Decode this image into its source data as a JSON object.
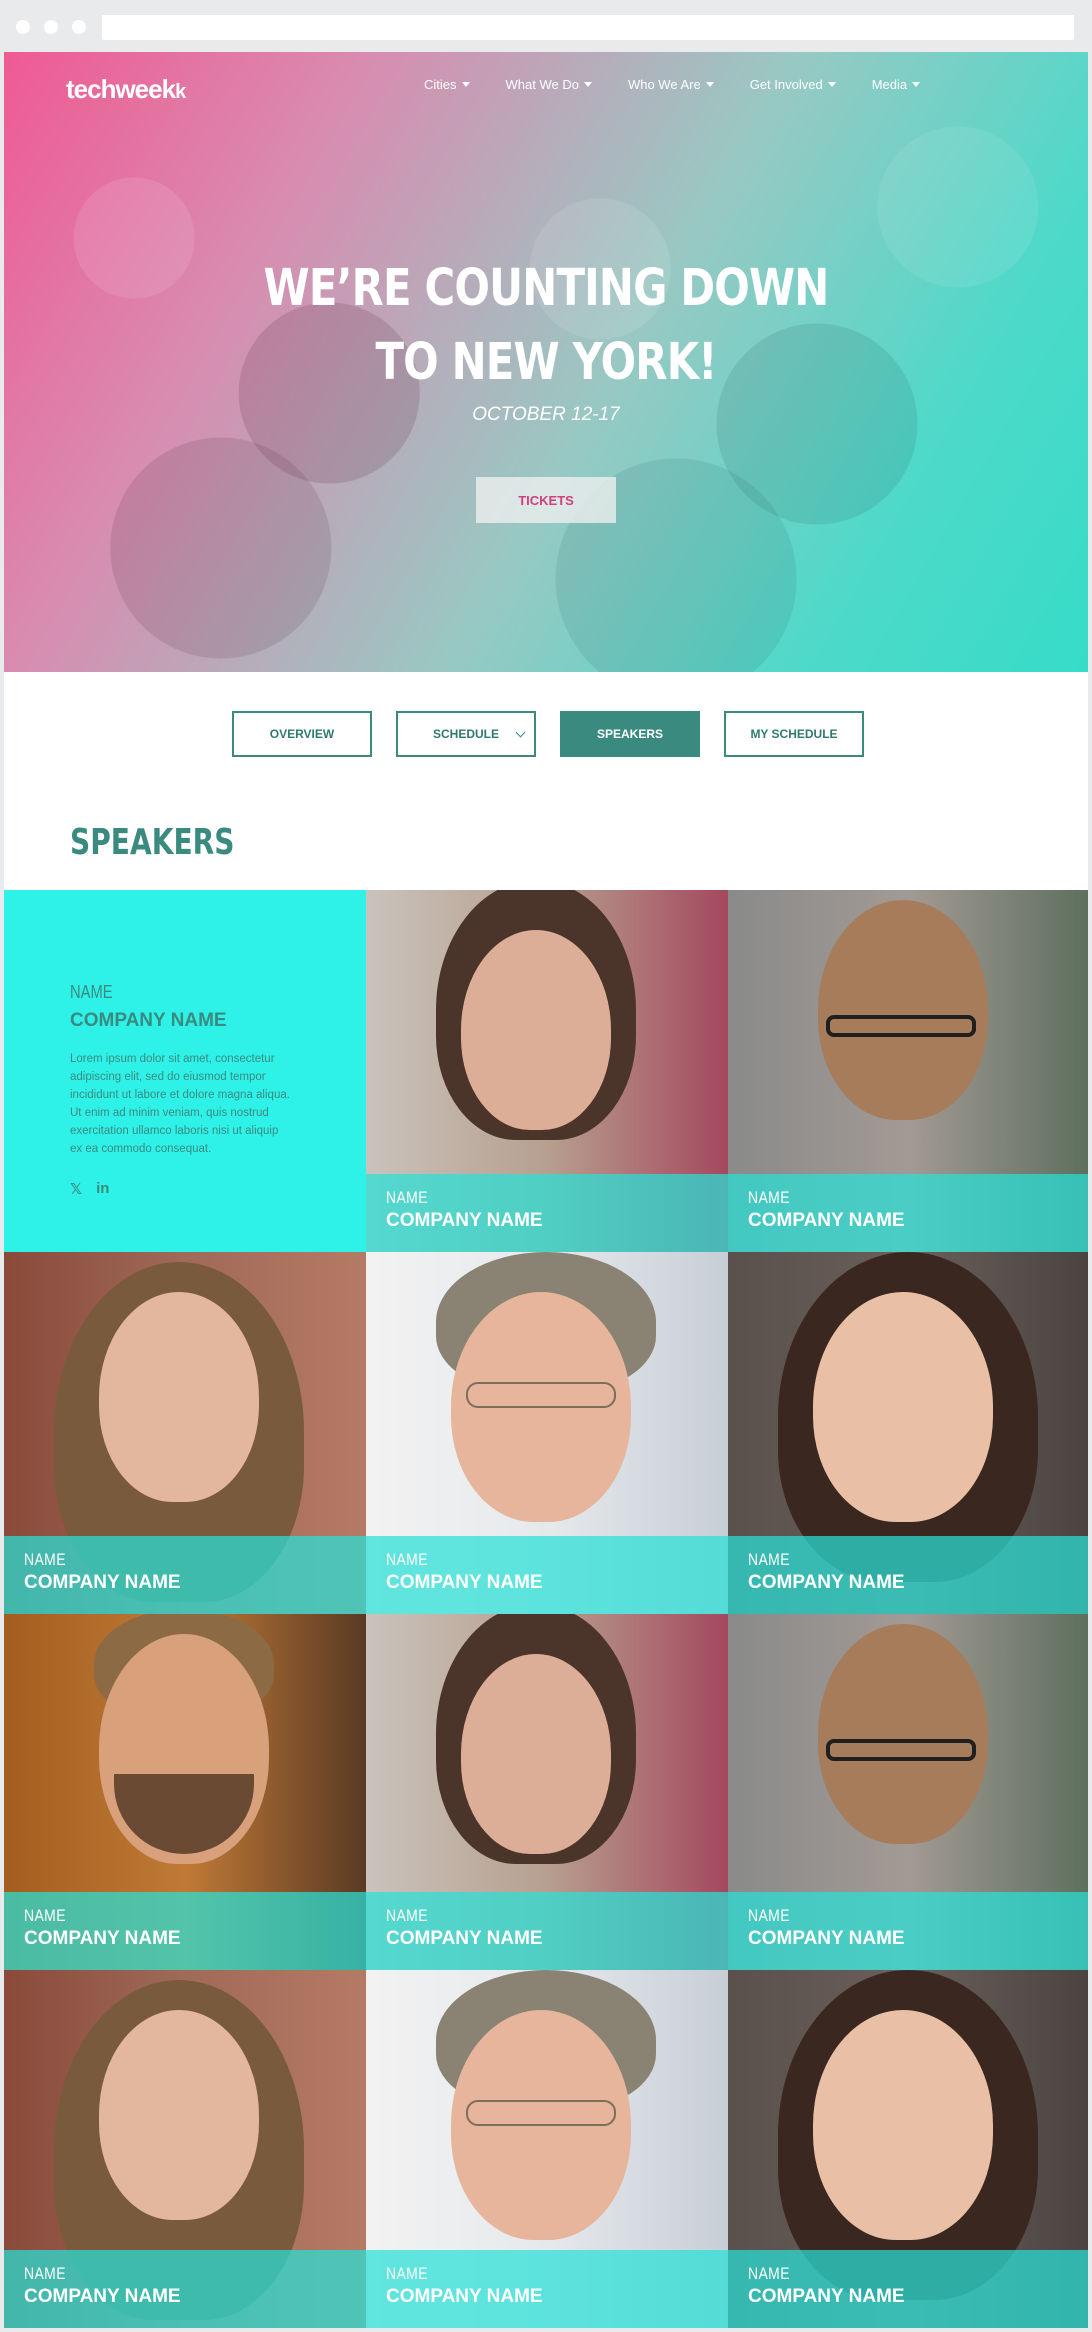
{
  "brand": {
    "logo": "techweek",
    "logo_mark": "k"
  },
  "nav": [
    {
      "label": "Cities"
    },
    {
      "label": "What We Do"
    },
    {
      "label": "Who We Are"
    },
    {
      "label": "Get Involved"
    },
    {
      "label": "Media"
    }
  ],
  "hero": {
    "title_line1": "WE’RE COUNTING DOWN",
    "title_line2": "TO NEW YORK!",
    "date": "OCTOBER 12-17",
    "cta": "TICKETS"
  },
  "tabs": [
    {
      "label": "OVERVIEW"
    },
    {
      "label": "SCHEDULE"
    },
    {
      "label": "SPEAKERS"
    },
    {
      "label": "MY SCHEDULE"
    }
  ],
  "section_title": "SPEAKERS",
  "featured_speaker": {
    "name": "NAME",
    "company": "COMPANY NAME",
    "bio": "Lorem ipsum dolor sit amet, consectetur adipiscing elit, sed do eiusmod tempor incididunt ut labore et dolore magna aliqua. Ut enim ad minim veniam, quis nostrud exercitation ullamco laboris nisi ut aliquip ex ea commodo consequat.",
    "social": [
      "twitter",
      "linkedin"
    ]
  },
  "speakers": [
    {
      "name": "NAME",
      "company": "COMPANY NAME"
    },
    {
      "name": "NAME",
      "company": "COMPANY NAME"
    },
    {
      "name": "NAME",
      "company": "COMPANY NAME"
    },
    {
      "name": "NAME",
      "company": "COMPANY NAME"
    },
    {
      "name": "NAME",
      "company": "COMPANY NAME"
    },
    {
      "name": "NAME",
      "company": "COMPANY NAME"
    },
    {
      "name": "NAME",
      "company": "COMPANY NAME"
    },
    {
      "name": "NAME",
      "company": "COMPANY NAME"
    },
    {
      "name": "NAME",
      "company": "COMPANY NAME"
    },
    {
      "name": "NAME",
      "company": "COMPANY NAME"
    },
    {
      "name": "NAME",
      "company": "COMPANY NAME"
    }
  ],
  "colors": {
    "teal": "#3b8a80",
    "cyan": "#2ef2e8",
    "pink": "#d0407c"
  }
}
